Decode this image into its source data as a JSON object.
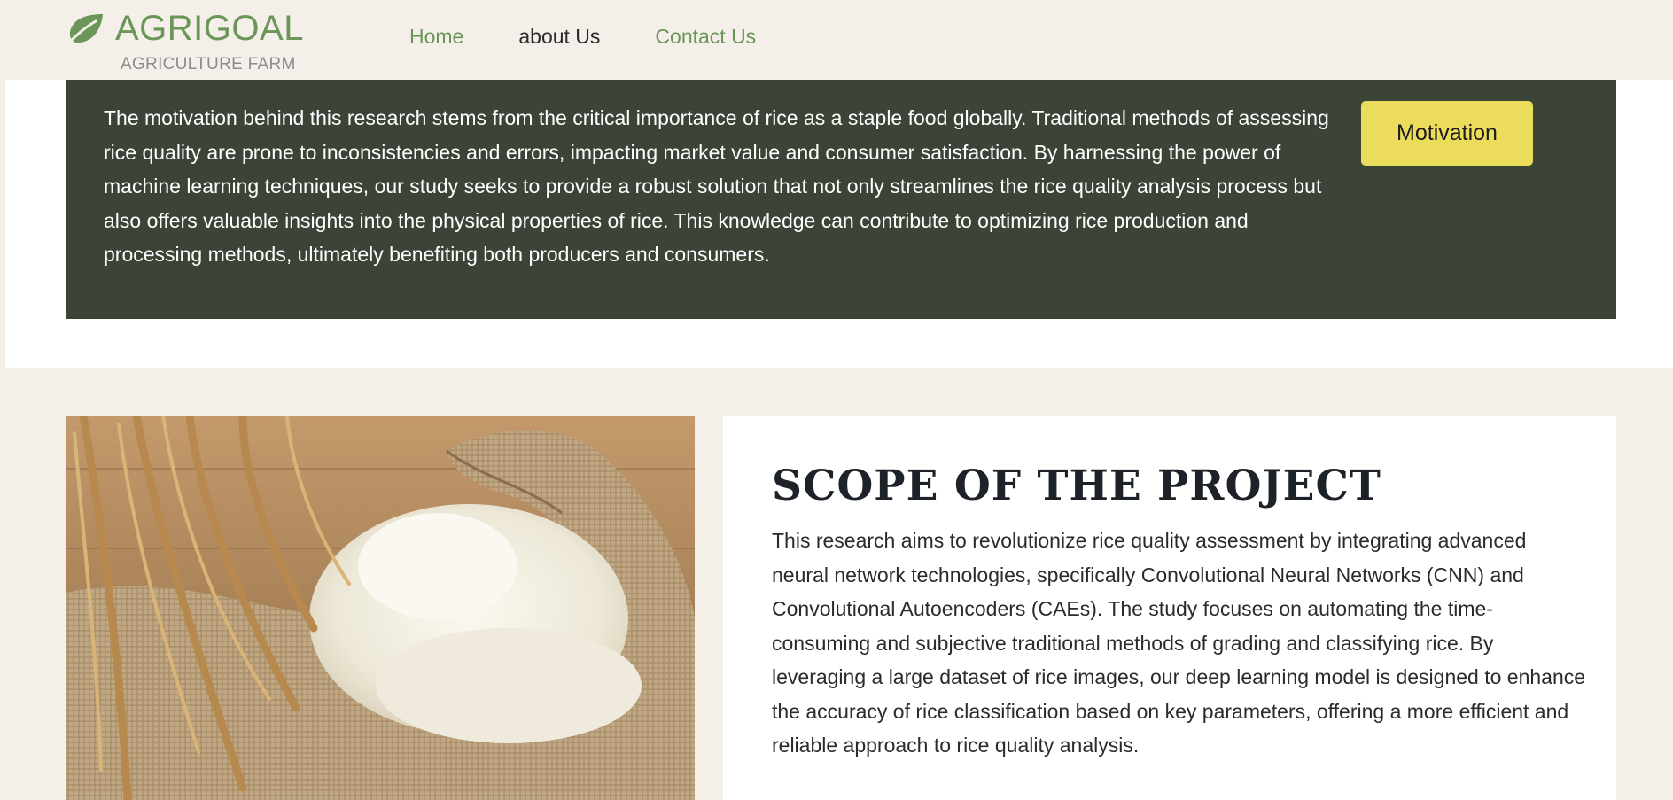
{
  "header": {
    "brand": {
      "name": "AGRIGOAL",
      "tagline": "AGRICULTURE FARM",
      "icon": "leaf-icon"
    },
    "nav": [
      {
        "label": "Home",
        "active": false
      },
      {
        "label": "about Us",
        "active": true
      },
      {
        "label": "Contact Us",
        "active": false
      }
    ]
  },
  "motivation": {
    "text": "The motivation behind this research stems from the critical importance of rice as a staple food globally. Traditional methods of assessing rice quality are prone to inconsistencies and errors, impacting market value and consumer satisfaction. By harnessing the power of machine learning techniques, our study seeks to provide a robust solution that not only streamlines the rice quality analysis process but also offers valuable insights into the physical properties of rice. This knowledge can contribute to optimizing rice production and processing methods, ultimately benefiting both producers and consumers.",
    "button_label": "Motivation"
  },
  "scope": {
    "title": "SCOPE OF THE PROJECT",
    "text": "This research aims to revolutionize rice quality assessment by integrating advanced neural network technologies, specifically Convolutional Neural Networks (CNN) and Convolutional Autoencoders (CAEs). The study focuses on automating the time-consuming and subjective traditional methods of grading and classifying rice. By leveraging a large dataset of rice images, our deep learning model is designed to enhance the accuracy of rice classification based on key parameters, offering a more efficient and reliable approach to rice quality analysis."
  },
  "colors": {
    "brand_green": "#6a9657",
    "header_bg": "#f4efe9",
    "banner_bg": "#3c4438",
    "button_yellow": "#ecdc5c",
    "title_dark": "#1d2228"
  }
}
